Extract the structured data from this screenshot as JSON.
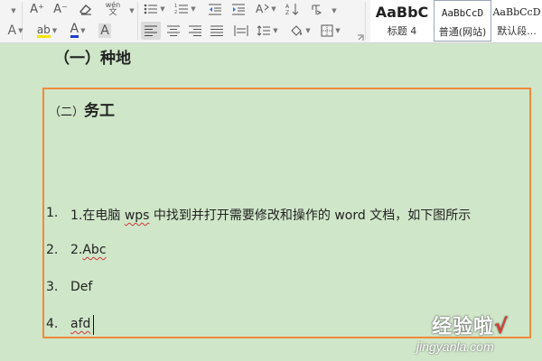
{
  "toolbar": {
    "row1": {
      "grow_font": "A⁺",
      "shrink_font": "A⁻",
      "phonetic_top": "wén",
      "phonetic_bottom": "文"
    },
    "row2": {
      "text_effect": "A",
      "highlight": "ab",
      "font_color": "A",
      "char_shading": "A"
    }
  },
  "styles": [
    {
      "sample": "AaBbC",
      "name": "标题 4"
    },
    {
      "sample": "AaBbCcD",
      "name": "普通(网站)"
    },
    {
      "sample": "AaBbCcD",
      "name": "默认段..."
    }
  ],
  "document": {
    "prev_heading": "（一）种地",
    "section_heading": {
      "paren": "（二）",
      "title": "务工"
    },
    "list": [
      {
        "num": "1.",
        "text": "1.在电脑 ",
        "squiggle": "wps",
        "text_after": " 中找到并打开需要修改和操作的 word 文档，如下图所示"
      },
      {
        "num": "2.",
        "text": "2.",
        "squiggle": "Abc",
        "text_after": ""
      },
      {
        "num": "3.",
        "text": "Def",
        "squiggle": "",
        "text_after": ""
      },
      {
        "num": "4.",
        "text": "",
        "squiggle": "afd",
        "text_after": ""
      }
    ]
  },
  "watermark": {
    "title": "经验啦",
    "check": "√",
    "url": "jingyanla.com"
  },
  "colors": {
    "page_background": "#cfe6c9",
    "frame_border": "#ef8a3a",
    "spell_squiggle": "#d23a3a"
  }
}
